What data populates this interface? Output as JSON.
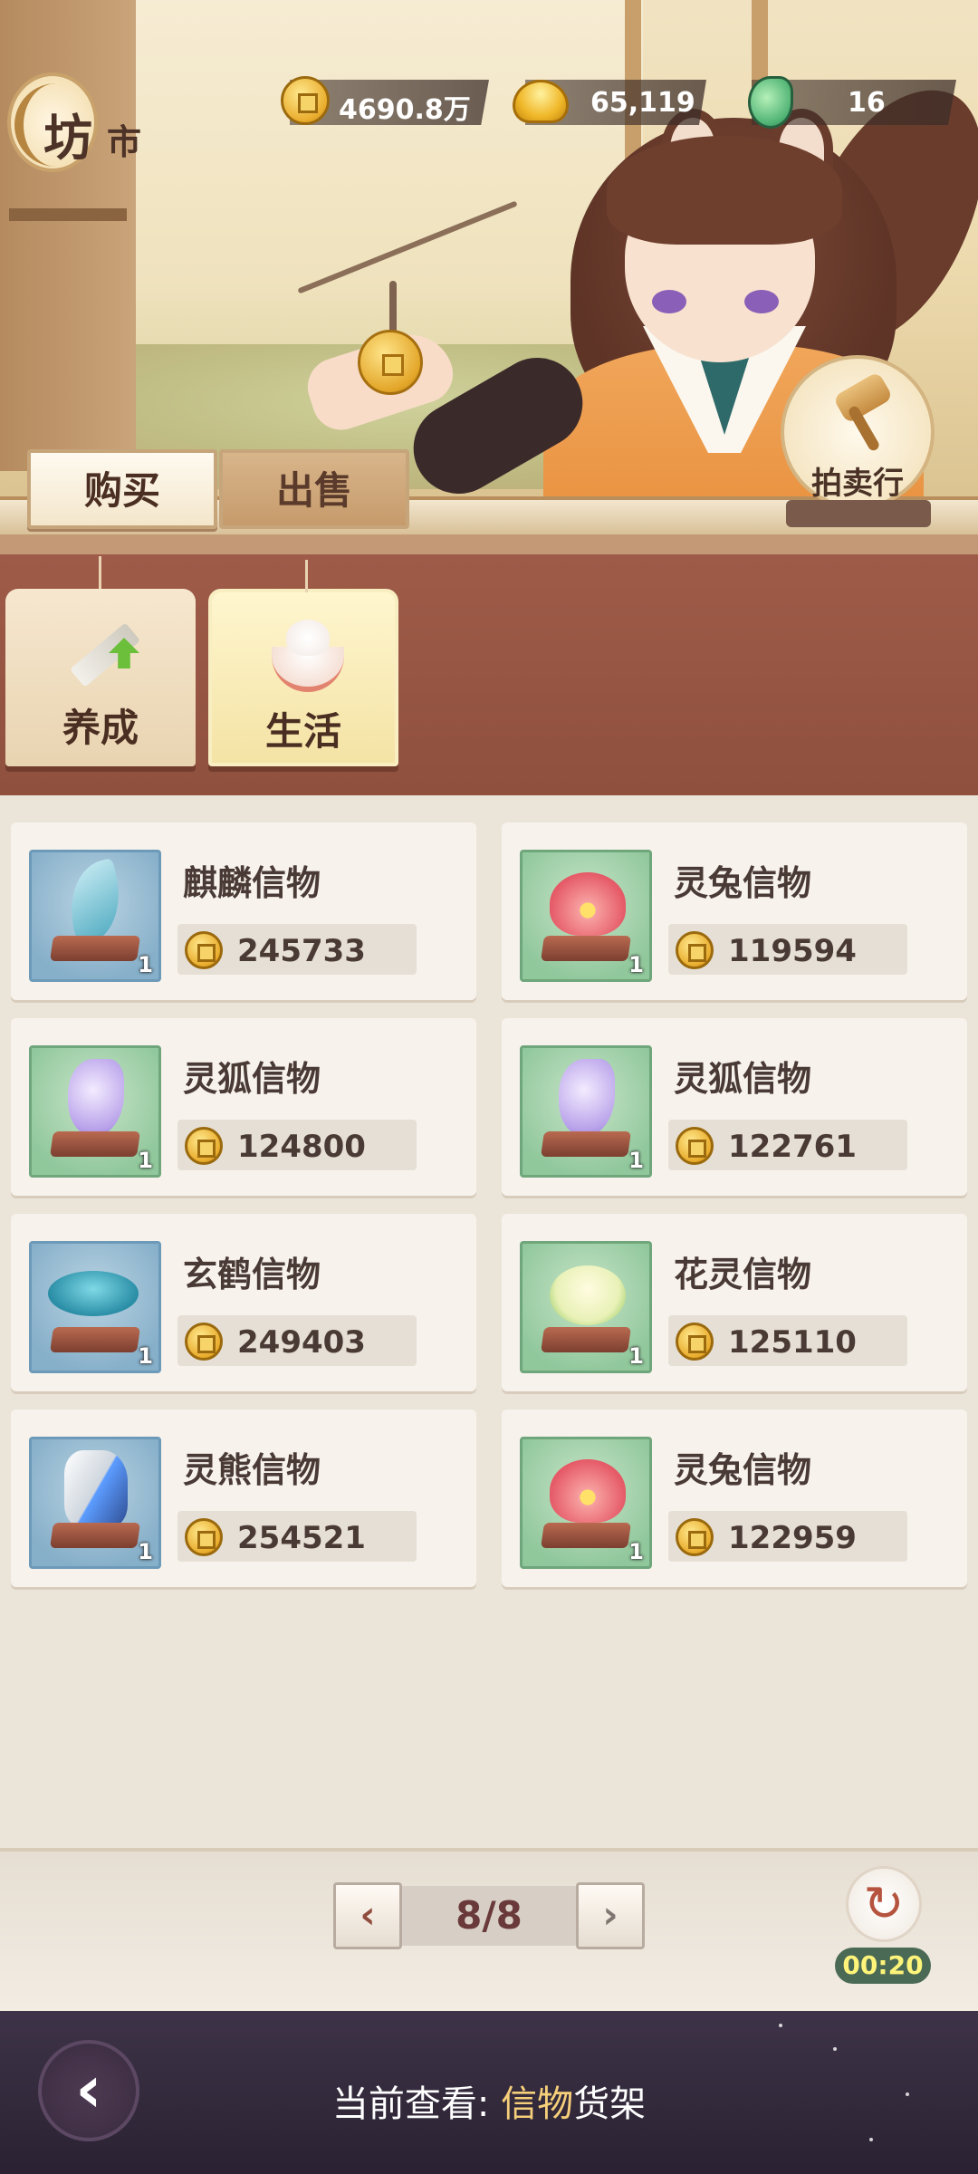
{
  "title": {
    "char1": "坊",
    "char2": "市"
  },
  "currencies": [
    {
      "icon": "copper-coin-icon",
      "value": "4690.8万"
    },
    {
      "icon": "gold-ingot-icon",
      "value": "65,119"
    },
    {
      "icon": "jade-token-icon",
      "value": "16"
    }
  ],
  "auction": {
    "label": "拍卖行"
  },
  "tabs": {
    "buy": "购买",
    "sell": "出售",
    "active": "buy"
  },
  "categories": [
    {
      "label": "养成",
      "icon": "sword-upgrade-icon"
    },
    {
      "label": "生活",
      "icon": "food-bowl-icon",
      "active": true
    }
  ],
  "items": [
    {
      "name": "麒麟信物",
      "price": "245733",
      "qty": "1",
      "bg": "blue",
      "icon": "qilin-token-icon"
    },
    {
      "name": "灵兔信物",
      "price": "119594",
      "qty": "1",
      "bg": "green",
      "icon": "lotus-token-icon"
    },
    {
      "name": "灵狐信物",
      "price": "124800",
      "qty": "1",
      "bg": "green",
      "icon": "fox-token-icon"
    },
    {
      "name": "灵狐信物",
      "price": "122761",
      "qty": "1",
      "bg": "green",
      "icon": "fox-token-icon"
    },
    {
      "name": "玄鹤信物",
      "price": "249403",
      "qty": "1",
      "bg": "blue",
      "icon": "crane-token-icon"
    },
    {
      "name": "花灵信物",
      "price": "125110",
      "qty": "1",
      "bg": "green",
      "icon": "flower-token-icon"
    },
    {
      "name": "灵熊信物",
      "price": "254521",
      "qty": "1",
      "bg": "blue",
      "icon": "bear-token-icon"
    },
    {
      "name": "灵兔信物",
      "price": "122959",
      "qty": "1",
      "bg": "green",
      "icon": "lotus-token-icon"
    }
  ],
  "pager": {
    "display": "8/8",
    "prev": "‹",
    "next": "›"
  },
  "refresh": {
    "timer": "00:20"
  },
  "footer": {
    "prefix": "当前查看: ",
    "highlight": "信物",
    "suffix": "货架"
  },
  "colors": {
    "accent": "#f6cf7a",
    "panel": "#9e5b48",
    "footer": "#2a2232"
  }
}
